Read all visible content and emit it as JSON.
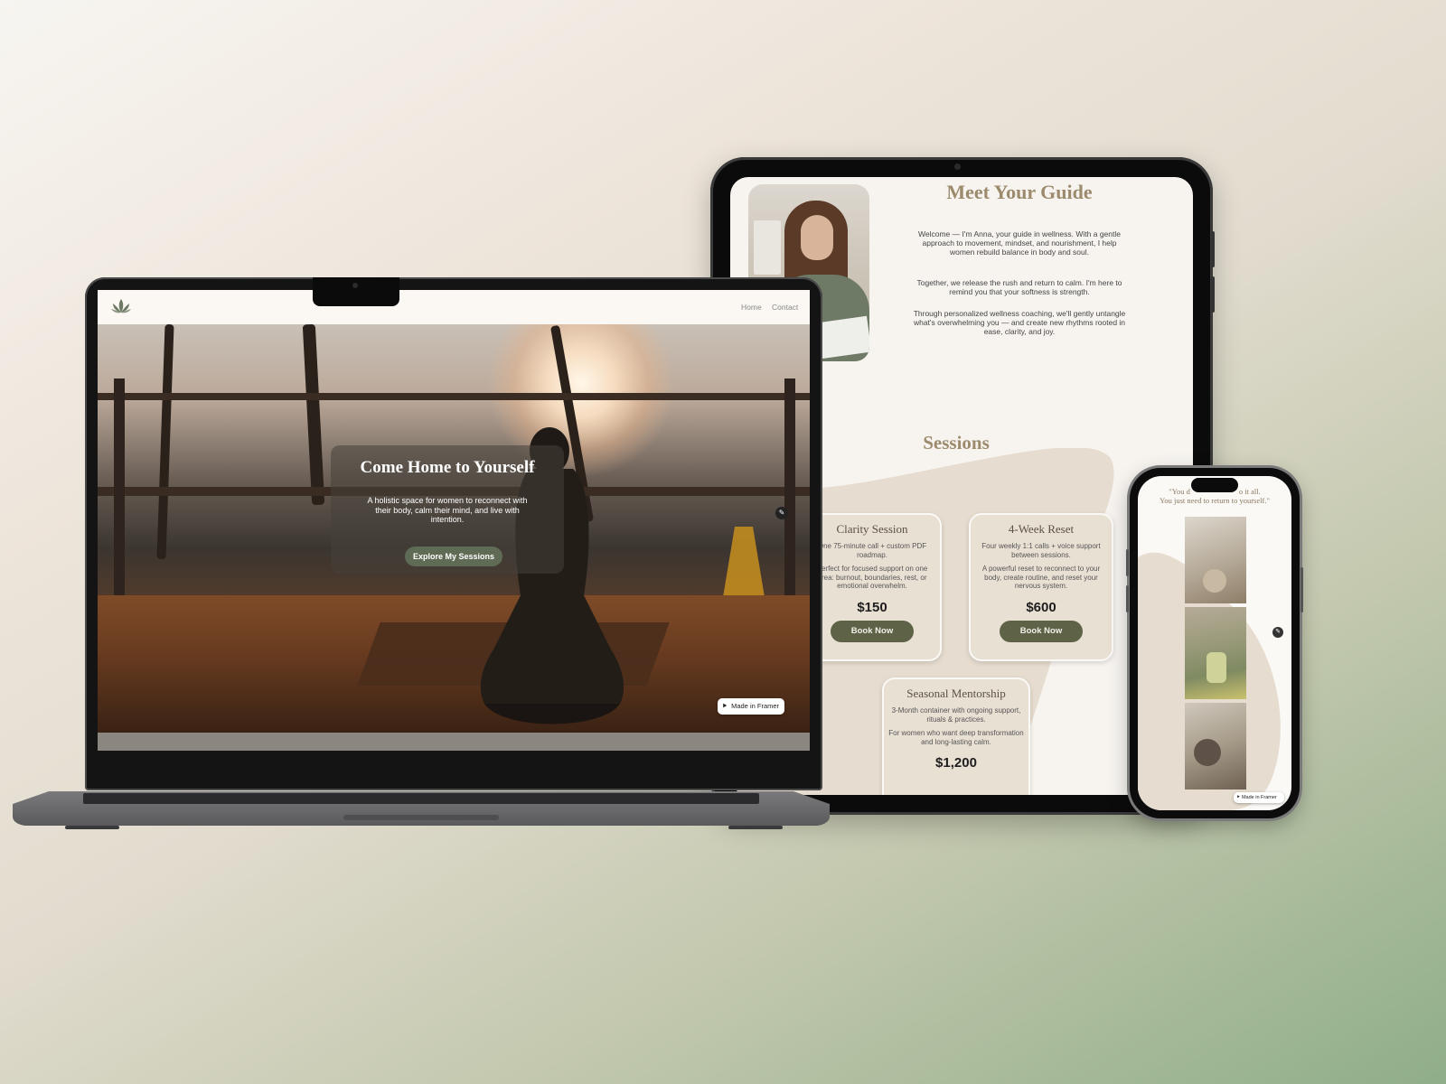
{
  "tablet": {
    "guide": {
      "title": "Meet Your Guide",
      "paragraphs": [
        "Welcome — I'm Anna, your guide in wellness. With a gentle approach to movement, mindset, and nourishment, I help women rebuild balance in body and soul.",
        "Together, we release the rush and return to calm. I'm here to remind you that your softness is strength.",
        "Through personalized wellness coaching, we'll gently untangle what's overwhelming you — and create new rhythms rooted in ease, clarity, and joy."
      ]
    },
    "sessions": {
      "title": "Sessions",
      "cards": [
        {
          "title": "Clarity Session",
          "desc1": "One 75-minute call + custom PDF roadmap.",
          "desc2": "Perfect for focused support on one area: burnout, boundaries, rest, or emotional overwhelm.",
          "price": "$150",
          "button": "Book Now"
        },
        {
          "title": "4-Week Reset",
          "desc1": "Four weekly 1:1 calls + voice support between sessions.",
          "desc2": "A powerful reset to reconnect to your body, create routine, and reset your nervous system.",
          "price": "$600",
          "button": "Book Now"
        },
        {
          "title": "Seasonal Mentorship",
          "desc1": "3-Month container with ongoing support, rituals & practices.",
          "desc2": "For women who want deep transformation and long-lasting calm.",
          "price": "$1,200"
        }
      ]
    }
  },
  "laptop": {
    "nav": {
      "home": "Home",
      "contact": "Contact",
      "logo_icon": "lotus-icon"
    },
    "hero": {
      "title": "Come Home to Yourself",
      "subtitle": "A holistic space for women to reconnect with their body, calm their mind, and live with intention.",
      "cta": "Explore My Sessions"
    },
    "badge": "Made in Framer"
  },
  "phone": {
    "quote_line1": "\"You d",
    "quote_line1_end": "o it all.",
    "quote_line2": "You just need to return to yourself.\"",
    "badge": "Made in Framer"
  },
  "colors": {
    "accent_green": "#5e6246",
    "heading_tan": "#9c8a6d",
    "card_bg": "#e9e0d4",
    "cta_green": "#5f6b55"
  }
}
